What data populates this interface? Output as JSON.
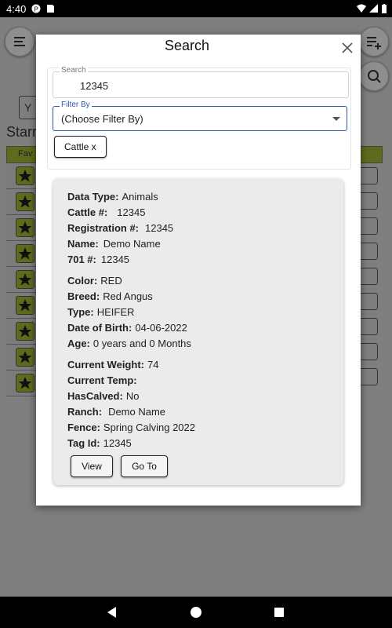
{
  "status_bar": {
    "time": "4:40"
  },
  "background": {
    "starred_label": "Starr",
    "fav_header": "Fav",
    "tab_stub": "Y"
  },
  "modal": {
    "title": "Search",
    "search_field": {
      "label": "Search",
      "value": "12345"
    },
    "filter_field": {
      "label": "Filter By",
      "value": "(Choose Filter By)"
    },
    "chip_label": "Cattle x"
  },
  "result": {
    "data_type": {
      "label": "Data Type:",
      "value": "Animals"
    },
    "cattle": {
      "label": "Cattle #:",
      "value": "12345"
    },
    "registration": {
      "label": "Registration #:",
      "value": "12345"
    },
    "name": {
      "label": "Name:",
      "value": "Demo Name"
    },
    "id701": {
      "label": "701 #:",
      "value": "12345"
    },
    "color": {
      "label": "Color:",
      "value": "RED"
    },
    "breed": {
      "label": "Breed:",
      "value": "Red Angus"
    },
    "type": {
      "label": "Type:",
      "value": "HEIFER"
    },
    "dob": {
      "label": "Date of Birth:",
      "value": "04-06-2022"
    },
    "age": {
      "label": "Age:",
      "value": "0 years and 0 Months"
    },
    "weight": {
      "label": "Current Weight:",
      "value": "74"
    },
    "temp": {
      "label": "Current Temp:",
      "value": ""
    },
    "calved": {
      "label": "HasCalved:",
      "value": "No"
    },
    "ranch": {
      "label": "Ranch:",
      "value": "Demo Name"
    },
    "fence": {
      "label": "Fence:",
      "value": "Spring Calving 2022"
    },
    "tag": {
      "label": "Tag Id:",
      "value": "12345"
    },
    "view_label": "View",
    "goto_label": "Go To"
  },
  "colors": {
    "accent_blue": "#2a5bb0",
    "fav_olive": "#5e6b1c",
    "card_bg": "#ebebeb"
  }
}
